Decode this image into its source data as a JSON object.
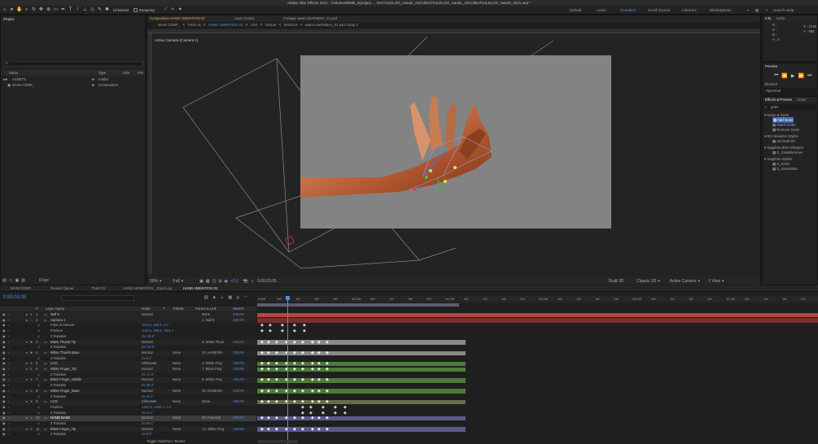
{
  "app": {
    "title": "Adobe After Effects 2021 - /Volumes/BMB_2/project … DA/YULELOG_Hands_AECollect/YULELOG_Hands_AECollect/YULELOG_Hands_2021.aep *",
    "snapping_label": "Snapping",
    "universal_label": "Universal",
    "workspaces": [
      "Default",
      "Learn",
      "Standard",
      "Small Screen",
      "Libraries",
      "BlinkMyBrain"
    ],
    "active_workspace": "Standard",
    "search_help": "Search Help"
  },
  "project": {
    "title": "Project",
    "columns": [
      "Name",
      "Type",
      "Size",
      "Frm"
    ],
    "items": [
      {
        "name": "ASSETS",
        "type": "Folder"
      },
      {
        "name": "MAIN COMP_",
        "type": "Composition"
      }
    ],
    "bpc": "8 bpc"
  },
  "viewer": {
    "tabs": [
      "Composition HAND ANIMATION 01",
      "Layer (none)",
      "Footage watercolorPattern_01.psd"
    ],
    "breadcrumbs": [
      "MAIN COMP_",
      "TAKE 01",
      "HAND ANIMATION 01",
      "LOG",
      "Texture",
      "WIGGLE",
      "watercolorPattern_01.psd Comp 2"
    ],
    "camera_label": "Active Camera (Camera 1)",
    "zoom": "50%",
    "quality": "Full",
    "timecode": "0:00:03:05",
    "renderer": "Draft 3D",
    "renderer_mode": "Classic 3D",
    "view_camera": "Active Camera",
    "view_layout": "1 View",
    "exposure": "+0.0"
  },
  "info": {
    "tabs": [
      "Info",
      "Audio"
    ],
    "values": [
      "R :",
      "G :",
      "B :",
      "A : 0"
    ],
    "coords": [
      "X : 1230",
      "Y : 996"
    ]
  },
  "preview": {
    "title": "Preview",
    "shortcut_label": "Shortcut",
    "shortcut_value": "Spacebar"
  },
  "effects": {
    "tabs": [
      "Effects & Presets",
      "Librari"
    ],
    "search": "grain",
    "groups": [
      {
        "name": "Noise & Grain",
        "items": [
          "Add Grain",
          "Match Grain",
          "Remove Grain"
        ]
      },
      {
        "name": "RG Universe Stylize",
        "items": [
          "uni.Grain16"
        ]
      },
      {
        "name": "Sapphire Blur+Sharpen",
        "items": [
          "S_GrainRemove"
        ]
      },
      {
        "name": "Sapphire Stylize",
        "items": [
          "S_Grain",
          "S_GrainStats"
        ]
      }
    ],
    "selected_item": "Add Grain"
  },
  "timeline": {
    "tabs": [
      "MAIN COMP_",
      "Render Queue",
      "TAKE 01",
      "HAND ANIMATION _ Ktool Log",
      "HAND ANIMATION 01"
    ],
    "active_tab": "HAND ANIMATION 01",
    "timecode": "0:00:03:05",
    "columns": [
      "#",
      "Layer Name",
      "Mode",
      "T",
      "TrkMat",
      "Parent & Link",
      "Stretch"
    ],
    "ruler": [
      "0:00f",
      "06f",
      "12f",
      "18f",
      "24f",
      "02:00f",
      "06f",
      "12f",
      "18f",
      "24f",
      "04:00f",
      "06f",
      "12f",
      "18f",
      "24f",
      "06:00f",
      "06f",
      "12f",
      "18f",
      "24f",
      "08:00f",
      "06f",
      "12f",
      "18f",
      "24f",
      "10:00f",
      "06f",
      "12f",
      "18f",
      "24f",
      "12:00f"
    ],
    "footer": "Toggle Switches / Modes",
    "rows": [
      {
        "num": "1",
        "name": "Null 9",
        "mode": "Normal",
        "trk": "",
        "parent": "None",
        "stretch": "100.0%",
        "bar": "#b04a3a",
        "kind": "layer"
      },
      {
        "num": "2",
        "name": "Camera 1",
        "mode": "",
        "trk": "",
        "parent": "1. Null 9",
        "stretch": "100.0%",
        "bar": "#7a2d2d",
        "kind": "layer"
      },
      {
        "num": "",
        "name": "Point of Interest",
        "mode": "-510.6, 466.8, 2.0",
        "trk": "",
        "parent": "",
        "stretch": "",
        "bar": "",
        "kind": "prop"
      },
      {
        "num": "",
        "name": "Position",
        "mode": "-510.6, 466.8, -863.4",
        "trk": "",
        "parent": "",
        "stretch": "",
        "bar": "",
        "kind": "prop"
      },
      {
        "num": "",
        "name": "Z Rotation",
        "mode": "0x+19.0°",
        "trk": "",
        "parent": "",
        "stretch": "",
        "bar": "",
        "kind": "prop"
      },
      {
        "num": "3",
        "name": "Black Thumb Tip",
        "mode": "Normal",
        "trk": "",
        "parent": "4. White Thum",
        "stretch": "100.0%",
        "bar": "#8a8a8a",
        "kind": "layer"
      },
      {
        "num": "",
        "name": "Z Rotation",
        "mode": "0x+10.0°",
        "trk": "",
        "parent": "",
        "stretch": "",
        "bar": "",
        "kind": "prop"
      },
      {
        "num": "4",
        "name": "White Thumb Base",
        "mode": "Normal",
        "trk": "None",
        "parent": "10. HAND BA",
        "stretch": "100.0%",
        "bar": "#8a8a8a",
        "kind": "layer"
      },
      {
        "num": "",
        "name": "Z Rotation",
        "mode": "0x-6.1°",
        "trk": "",
        "parent": "",
        "stretch": "",
        "bar": "",
        "kind": "prop"
      },
      {
        "num": "5",
        "name": "LOG",
        "mode": "Silhouette",
        "trk": "None",
        "parent": "4. White Fing",
        "stretch": "100.0%",
        "bar": "#4e7a3a",
        "kind": "layer"
      },
      {
        "num": "6",
        "name": "White Finger_Tip",
        "mode": "Normal",
        "trk": "None",
        "parent": "7. Black Fing",
        "stretch": "100.0%",
        "bar": "#4e7a3a",
        "kind": "layer"
      },
      {
        "num": "",
        "name": "Z Rotation",
        "mode": "0x-17.0°",
        "trk": "",
        "parent": "",
        "stretch": "",
        "bar": "",
        "kind": "prop"
      },
      {
        "num": "7",
        "name": "Black Finger_middle",
        "mode": "Normal",
        "trk": "None",
        "parent": "8. White Fing",
        "stretch": "100.0%",
        "bar": "#4e7a3a",
        "kind": "layer"
      },
      {
        "num": "",
        "name": "Z Rotation",
        "mode": "0x-30.4°",
        "trk": "",
        "parent": "",
        "stretch": "",
        "bar": "",
        "kind": "prop"
      },
      {
        "num": "8",
        "name": "White Finger_Base",
        "mode": "Normal",
        "trk": "None",
        "parent": "10. HAND BA",
        "stretch": "100.0%",
        "bar": "#4e7a3a",
        "kind": "layer"
      },
      {
        "num": "",
        "name": "Z Rotation",
        "mode": "0x-31.1°",
        "trk": "",
        "parent": "",
        "stretch": "",
        "bar": "",
        "kind": "prop"
      },
      {
        "num": "9",
        "name": "LOG",
        "mode": "Silhouette",
        "trk": "None",
        "parent": "None",
        "stretch": "100.0%",
        "bar": "#6b6a4a",
        "kind": "layer"
      },
      {
        "num": "",
        "name": "Position",
        "mode": "1402.6, 1086.3, 0.0",
        "trk": "",
        "parent": "",
        "stretch": "",
        "bar": "",
        "kind": "prop"
      },
      {
        "num": "",
        "name": "Z Rotation",
        "mode": "0x+9.1°",
        "trk": "",
        "parent": "",
        "stretch": "",
        "bar": "",
        "kind": "prop"
      },
      {
        "num": "10",
        "name": "HAND BASE",
        "mode": "Normal",
        "trk": "None",
        "parent": "20. ForeArm",
        "stretch": "100.0%",
        "bar": "#5a5a8a",
        "kind": "layer",
        "selected": true
      },
      {
        "num": "",
        "name": "Z Rotation",
        "mode": "0x-53.1°",
        "trk": "",
        "parent": "",
        "stretch": "",
        "bar": "",
        "kind": "prop"
      },
      {
        "num": "11",
        "name": "Black Finger_Tip",
        "mode": "Normal",
        "trk": "None",
        "parent": "12. White Fing",
        "stretch": "100.0%",
        "bar": "#5a5a8a",
        "kind": "layer"
      },
      {
        "num": "",
        "name": "Z Rotation",
        "mode": "0x-9.0°",
        "trk": "",
        "parent": "",
        "stretch": "",
        "bar": "",
        "kind": "prop"
      }
    ]
  },
  "colors": {
    "accent": "#4d8fe5",
    "playhead": "#4d8fe5",
    "canvas": "#838383"
  }
}
